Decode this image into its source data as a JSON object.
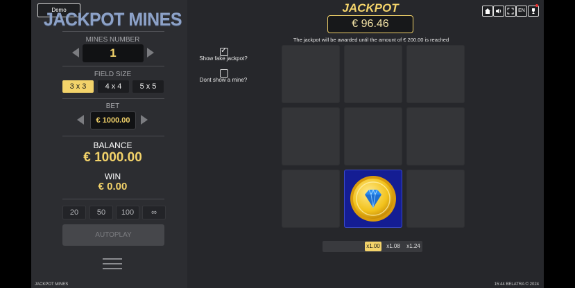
{
  "mode_badge": "Demo",
  "logo_text": "JACKPOT MINES",
  "mines": {
    "label": "MINES NUMBER",
    "value": "1"
  },
  "field_size": {
    "label": "FIELD SIZE",
    "options": [
      "3 x 3",
      "4 x 4",
      "5 x 5"
    ],
    "selected": "3 x 3"
  },
  "bet": {
    "label": "BET",
    "value": "€ 1000.00"
  },
  "balance": {
    "label": "BALANCE",
    "value": "€ 1000.00"
  },
  "win": {
    "label": "WIN",
    "value": "€ 0.00"
  },
  "quick_bets": [
    "20",
    "50",
    "100",
    "∞"
  ],
  "autoplay_label": "AUTOPLAY",
  "options": {
    "show_fake_jackpot": {
      "label": "Show fake jackpot?",
      "checked": true
    },
    "dont_show_mine": {
      "label": "Dont show a mine?",
      "checked": false
    }
  },
  "jackpot": {
    "title": "JACKPOT",
    "value": "€ 96.46",
    "note": "The jackpot will be awarded until the amount of € 200.00 is reached"
  },
  "board": {
    "size": 3,
    "revealed": [
      7
    ]
  },
  "multipliers": [
    "x1.00",
    "x1.08",
    "x1.24"
  ],
  "active_multiplier": "x1.00",
  "toolbar": {
    "lang": "EN",
    "icons": [
      "home-icon",
      "sound-icon",
      "fullscreen-icon",
      "trophy-icon"
    ]
  },
  "footer": {
    "game_name": "JACKPOT MINES",
    "time_copyright": "15:44  BELATRA © 2024"
  },
  "colors": {
    "accent": "#f3d36a",
    "background": "#26272b",
    "tile": "#343538",
    "revealed_tile": "#141d93"
  }
}
